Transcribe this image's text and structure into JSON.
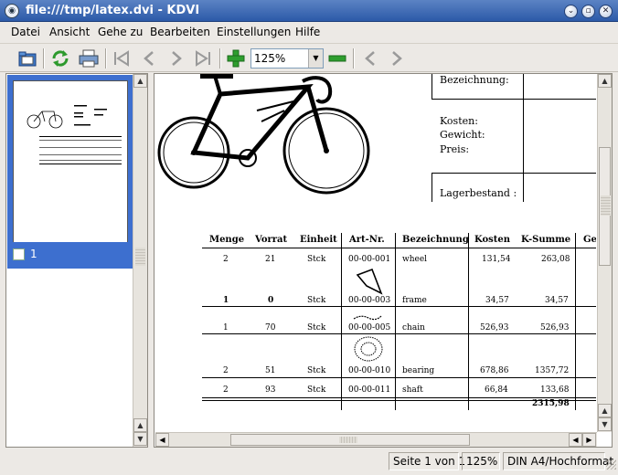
{
  "window": {
    "title": "file:///tmp/latex.dvi - KDVI",
    "app_icon": "kdvi-icon"
  },
  "menu": {
    "items": [
      {
        "label": "Datei"
      },
      {
        "label": "Ansicht"
      },
      {
        "label": "Gehe zu"
      },
      {
        "label": "Bearbeiten"
      },
      {
        "label": "Einstellungen"
      },
      {
        "label": "Hilfe"
      }
    ]
  },
  "toolbar": {
    "zoom_value": "125%",
    "icons": [
      "open-folder-icon",
      "reload-icon",
      "print-icon",
      "first-page-icon",
      "previous-page-icon",
      "next-page-icon",
      "last-page-icon",
      "zoom-in-icon",
      "zoom-out-icon",
      "back-icon",
      "forward-icon"
    ]
  },
  "sidebar": {
    "thumbnails": [
      {
        "page_label": "1",
        "selected": true
      }
    ]
  },
  "document": {
    "form_labels": {
      "bezeichnung": "Bezeichnung:",
      "kosten": "Kosten:",
      "gewicht": "Gewicht:",
      "preis": "Preis:",
      "lagerbestand": "Lagerbestand :"
    },
    "table": {
      "headers": [
        "Menge",
        "Vorrat",
        "Einheit",
        "Art-Nr.",
        "Bezeichnung",
        "Kosten",
        "K-Summe",
        "Ge"
      ],
      "rows": [
        {
          "menge": "2",
          "vorrat": "21",
          "einheit": "Stck",
          "artnr": "00-00-001",
          "bez": "wheel",
          "kosten": "131,54",
          "ksumme": "263,08",
          "bold": false
        },
        {
          "menge": "1",
          "vorrat": "0",
          "einheit": "Stck",
          "artnr": "00-00-003",
          "bez": "frame",
          "kosten": "34,57",
          "ksumme": "34,57",
          "bold": true
        },
        {
          "menge": "1",
          "vorrat": "70",
          "einheit": "Stck",
          "artnr": "00-00-005",
          "bez": "chain",
          "kosten": "526,93",
          "ksumme": "526,93",
          "bold": false
        },
        {
          "menge": "2",
          "vorrat": "51",
          "einheit": "Stck",
          "artnr": "00-00-010",
          "bez": "bearing",
          "kosten": "678,86",
          "ksumme": "1357,72",
          "bold": false
        },
        {
          "menge": "2",
          "vorrat": "93",
          "einheit": "Stck",
          "artnr": "00-00-011",
          "bez": "shaft",
          "kosten": "66,84",
          "ksumme": "133,68",
          "bold": false
        }
      ],
      "total": "2315,98"
    }
  },
  "statusbar": {
    "page": "Seite 1 von 1",
    "zoom": "125%",
    "format": "DIN A4/Hochformat"
  }
}
